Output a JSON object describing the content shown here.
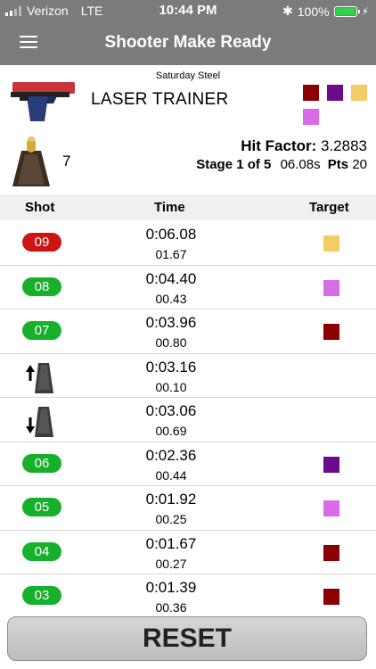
{
  "status_bar": {
    "carrier": "Verizon",
    "network": "LTE",
    "time": "10:44 PM",
    "battery": "100%"
  },
  "nav": {
    "title": "Shooter Make Ready"
  },
  "match": {
    "name": "Saturday Steel",
    "division": "LASER TRAINER",
    "target_colors": [
      "#8b0000",
      "#6a0a8c",
      "#f4cb64",
      "#d86be8"
    ],
    "magazine_count": "7",
    "hit_factor_label": "Hit Factor:",
    "hit_factor_value": "3.2883",
    "stage_label": "Stage 1 of 5",
    "stage_time": "06.08s",
    "points_label": "Pts",
    "points_value": "20"
  },
  "table": {
    "headers": {
      "shot": "Shot",
      "time": "Time",
      "target": "Target"
    },
    "rows": [
      {
        "type": "shot",
        "shot": "09",
        "color": "red",
        "time": "0:06.08",
        "split": "01.67",
        "target": "#f4cb64"
      },
      {
        "type": "shot",
        "shot": "08",
        "color": "green",
        "time": "0:04.40",
        "split": "00.43",
        "target": "#d86be8"
      },
      {
        "type": "shot",
        "shot": "07",
        "color": "green",
        "time": "0:03.96",
        "split": "00.80",
        "target": "#8b0000"
      },
      {
        "type": "reload-out",
        "icon": "magazine-eject-icon",
        "time": "0:03.16",
        "split": "00.10"
      },
      {
        "type": "reload-in",
        "icon": "magazine-insert-icon",
        "time": "0:03.06",
        "split": "00.69"
      },
      {
        "type": "shot",
        "shot": "06",
        "color": "green",
        "time": "0:02.36",
        "split": "00.44",
        "target": "#6a0a8c"
      },
      {
        "type": "shot",
        "shot": "05",
        "color": "green",
        "time": "0:01.92",
        "split": "00.25",
        "target": "#d86be8"
      },
      {
        "type": "shot",
        "shot": "04",
        "color": "green",
        "time": "0:01.67",
        "split": "00.27",
        "target": "#8b0000"
      },
      {
        "type": "shot",
        "shot": "03",
        "color": "green",
        "time": "0:01.39",
        "split": "00.36",
        "target": "#8b0000"
      }
    ]
  },
  "reset_label": "RESET"
}
